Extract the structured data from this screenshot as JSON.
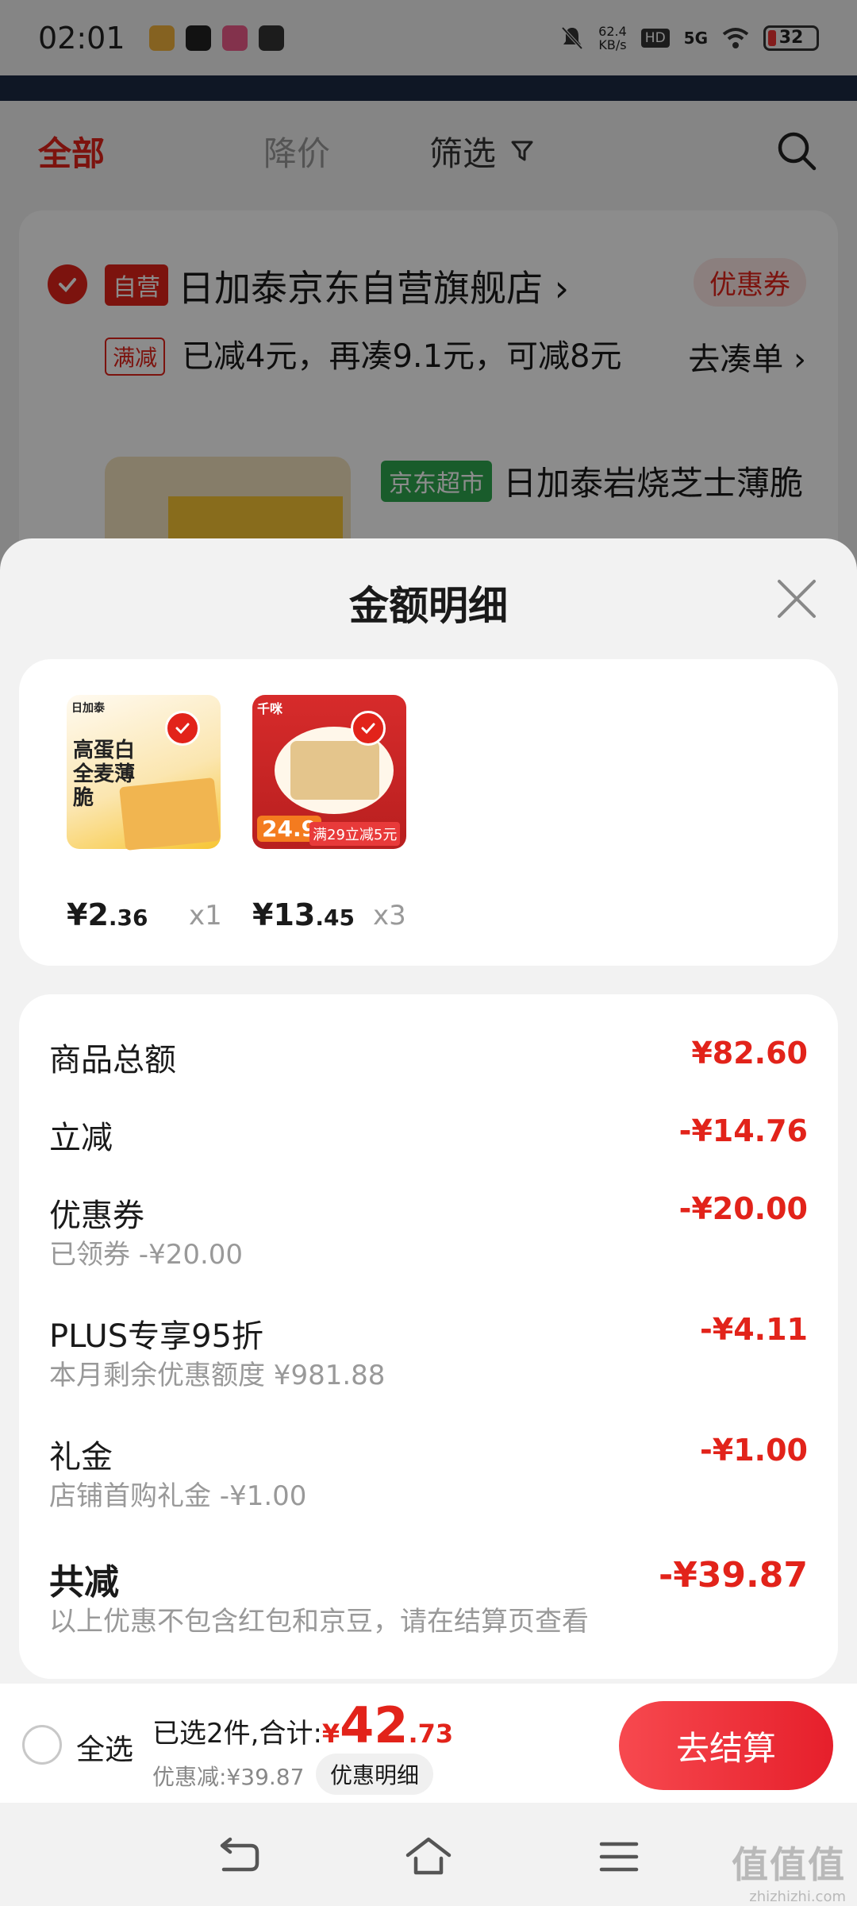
{
  "status_bar": {
    "time": "02:01",
    "net_speed_value": "62.4",
    "net_speed_unit": "KB/s",
    "hd": "HD",
    "signal": "5G",
    "battery": "32"
  },
  "filter_tabs": {
    "all": "全部",
    "price_drop": "降价",
    "filter": "筛选"
  },
  "store": {
    "self_tag": "自营",
    "name": "日加泰京东自营旗舰店 ›",
    "coupon": "优惠券",
    "promo_tag": "满减",
    "promo_text": "已减4元，再凑9.1元，可减8元",
    "go_order": "去凑单 ›",
    "product_tag": "京东超市",
    "product_name": "日加泰岩烧芝士薄脆"
  },
  "sheet": {
    "title": "金额明细",
    "goods": [
      {
        "price_int": "¥2",
        "price_dec": ".36",
        "qty": "x1",
        "img_brand": "日加泰",
        "img_text": "高蛋白全麦薄脆"
      },
      {
        "price_int": "¥13",
        "price_dec": ".45",
        "qty": "x3",
        "img_brand": "千咪",
        "img_price": "24.9",
        "img_promo": "满29立减5元"
      }
    ],
    "rows": [
      {
        "label": "商品总额",
        "value": "¥82.60",
        "sub": ""
      },
      {
        "label": "立减",
        "value": "-¥14.76",
        "sub": ""
      },
      {
        "label": "优惠券",
        "value": "-¥20.00",
        "sub": "已领券 -¥20.00"
      },
      {
        "label": "PLUS专享95折",
        "value": "-¥4.11",
        "sub": "本月剩余优惠额度 ¥981.88"
      },
      {
        "label": "礼金",
        "value": "-¥1.00",
        "sub": "店铺首购礼金 -¥1.00"
      },
      {
        "label": "共减",
        "value": "-¥39.87",
        "sub": "以上优惠不包含红包和京豆，请在结算页查看"
      }
    ]
  },
  "checkout": {
    "select_all": "全选",
    "selected_text": "已选2件,合计:",
    "total_yen": "¥",
    "total_int": "42",
    "total_dec": ".73",
    "saved": "优惠减:¥39.87",
    "detail_link": "优惠明细",
    "button": "去结算"
  },
  "watermark": {
    "main": "值值值",
    "sub": "zhizhizhi.com"
  },
  "colors": {
    "brand_red": "#e2231a",
    "jd_green": "#2fa84f"
  }
}
